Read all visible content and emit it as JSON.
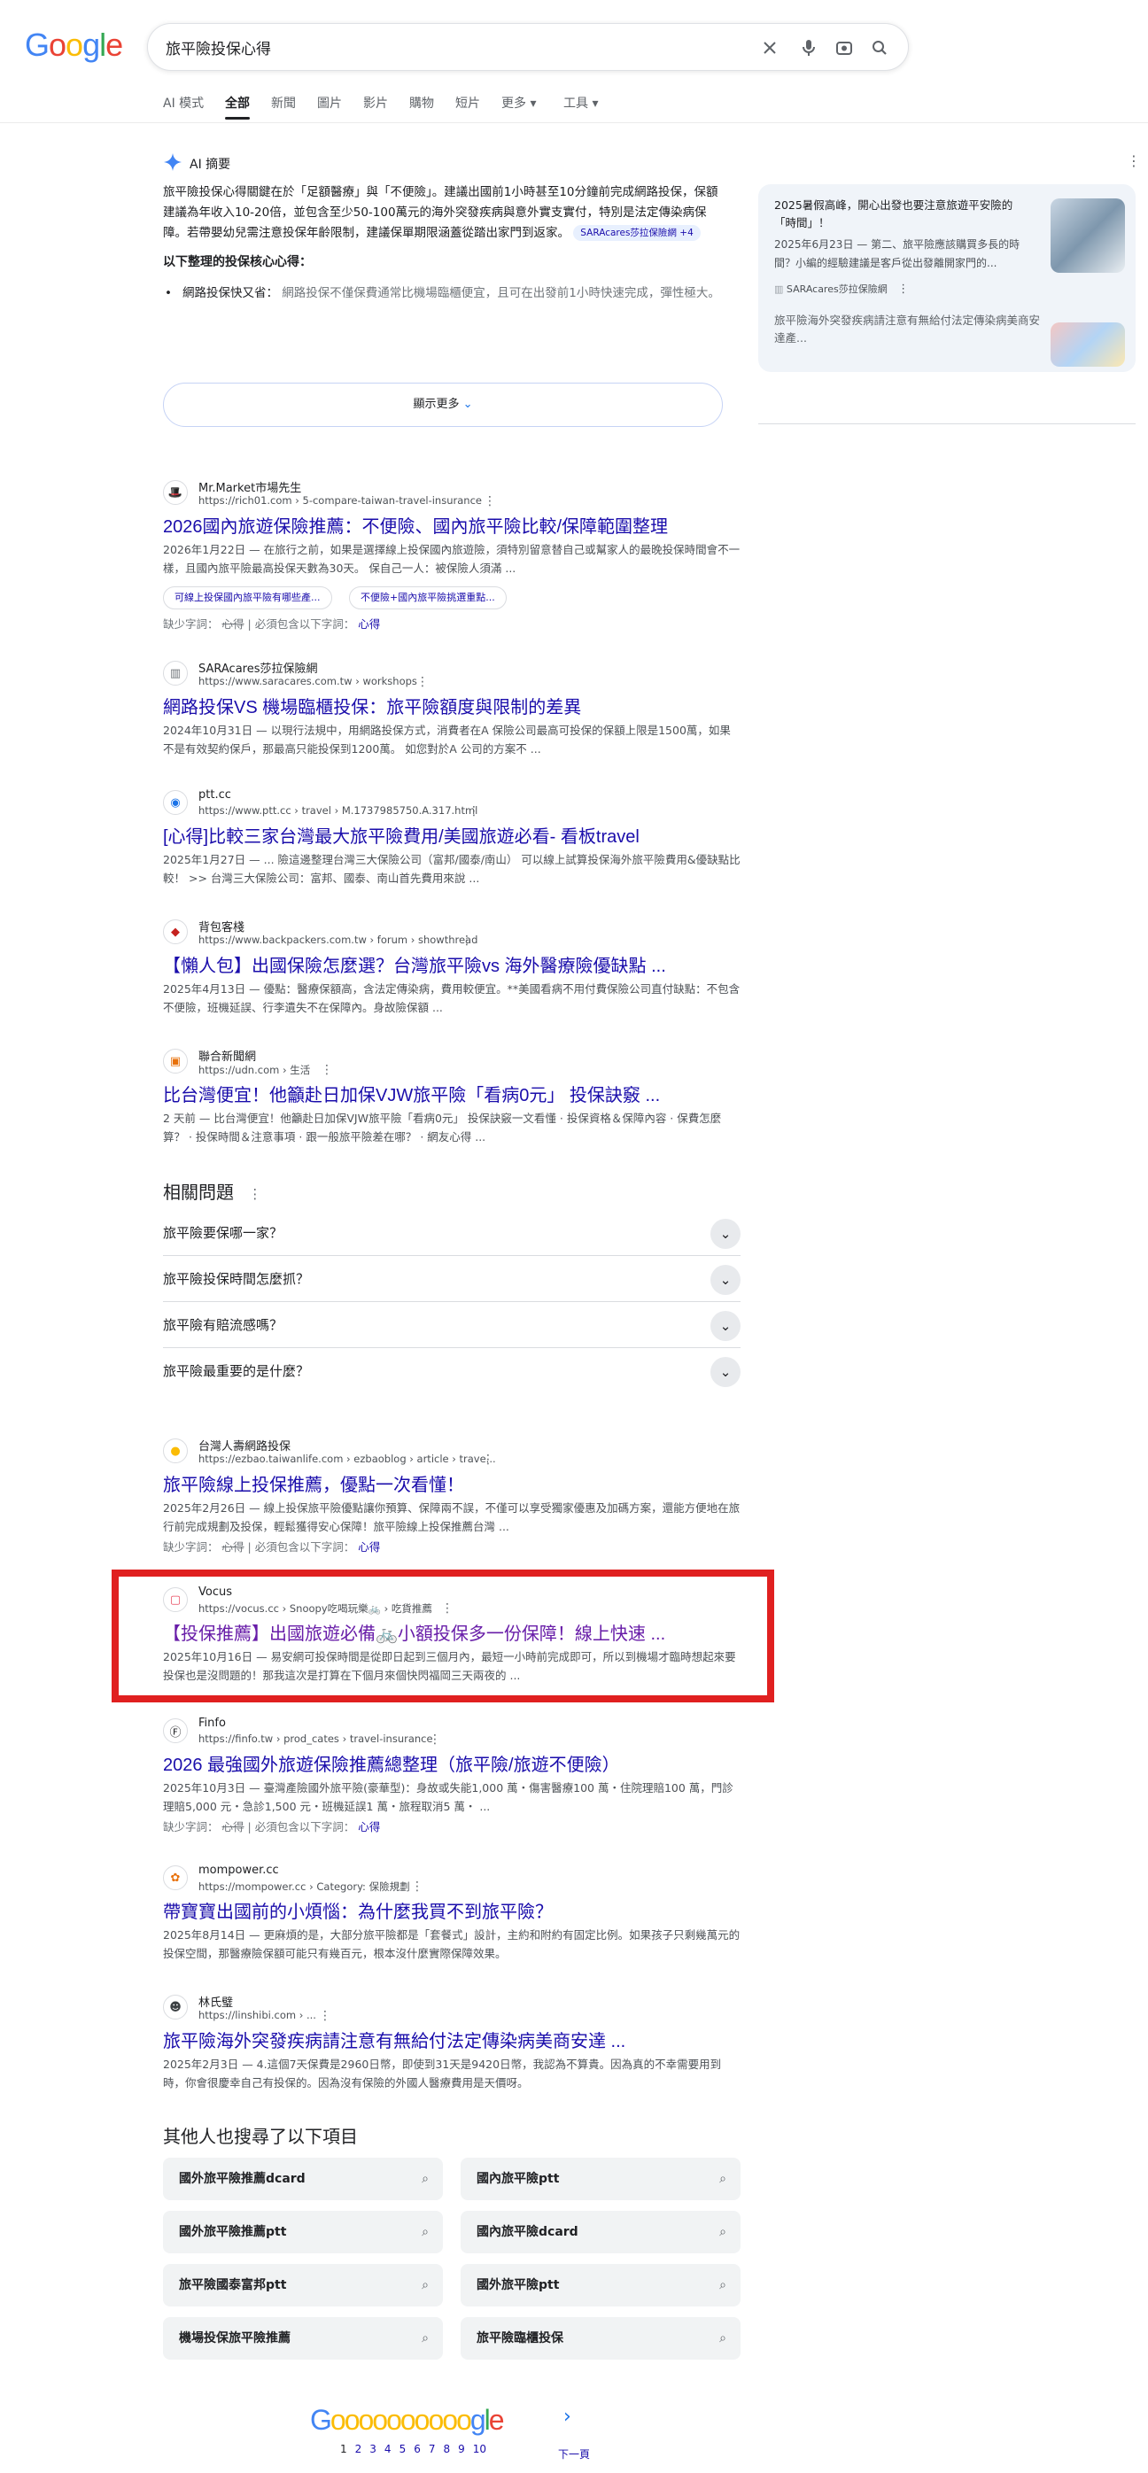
{
  "header": {
    "logo": "Google",
    "search_query": "旅平險投保心得",
    "tabs": [
      "AI 模式",
      "全部",
      "新聞",
      "圖片",
      "影片",
      "購物",
      "短片",
      "更多",
      "工具"
    ]
  },
  "ai_overview": {
    "label": "AI 摘要",
    "body": "旅平險投保心得關鍵在於「足額醫療」與「不便險」。建議出國前1小時甚至10分鐘前完成網路投保，保額建議為年收入10-20倍，並包含至少50-100萬元的海外突發疾病與意外實支實付，特別是法定傳染病保障。若帶嬰幼兒需注意投保年齡限制，建議保單期限涵蓋從踏出家門到返家。",
    "chip": "SARAcares莎拉保險網 +4",
    "subhead": "以下整理的投保核心心得：",
    "bullet_label": "網路投保快又省：",
    "bullet_text": "網路投保不僅保費通常比機場臨櫃便宜，且可在出發前1小時快速完成，彈性極大。",
    "show_more": "顯示更多",
    "side_cards": [
      {
        "title": "2025暑假高峰，開心出發也要注意旅遊平安險的「時間」！",
        "snippet": "2025年6月23日 — 第二、旅平險應該購買多長的時間？小編的經驗建議是客戶從出發離開家門的...",
        "source": "SARAcares莎拉保險網"
      },
      {
        "title": "旅平險海外突發疾病請注意有無給付法定傳染病美商安達產..."
      }
    ]
  },
  "results": [
    {
      "site": "Mr.Market市場先生",
      "url": "https://rich01.com › 5-compare-taiwan-travel-insurance",
      "title": "2026國內旅遊保險推薦：不便險、國內旅平險比較/保障範圍整理",
      "snippet": "2026年1月22日 — 在旅行之前，如果是選擇線上投保國內旅遊險，須特別留意替自己或幫家人的最晚投保時間會不一樣，且國內旅平險最高投保天數為30天。 保自己一人：被保險人須滿 ...",
      "pills": [
        "可線上投保國內旅平險有哪些產...",
        "不便險+國內旅平險挑選重點..."
      ],
      "missing_label": "缺少字詞：",
      "missing_word": "心得",
      "must_label": "必須包含以下字詞：",
      "must_word": "心得"
    },
    {
      "site": "SARAcares莎拉保險網",
      "url": "https://www.saracares.com.tw › workshops",
      "title": "網路投保VS 機場臨櫃投保：旅平險額度與限制的差異",
      "snippet": "2024年10月31日 — 以現行法規中，用網路投保方式，消費者在A 保險公司最高可投保的保額上限是1500萬，如果不是有效契約保戶，那最高只能投保到1200萬。 如您對於A 公司的方案不 ..."
    },
    {
      "site": "ptt.cc",
      "url": "https://www.ptt.cc › travel › M.1737985750.A.317.html",
      "title": "[心得]比較三家台灣最大旅平險費用/美國旅遊必看- 看板travel",
      "snippet": "2025年1月27日 — ... 險這邊整理台灣三大保險公司（富邦/國泰/南山） 可以線上試算投保海外旅平險費用&優缺點比較！ >> 台灣三大保險公司：富邦、國泰、南山首先費用來說 ..."
    },
    {
      "site": "背包客棧",
      "url": "https://www.backpackers.com.tw › forum › showthread",
      "title": "【懶人包】出國保險怎麼選？台灣旅平險vs 海外醫療險優缺點 ...",
      "snippet": "2025年4月13日 — 優點：醫療保額高，含法定傳染病，費用較便宜。**美國看病不用付費保險公司直付缺點：不包含不便險，班機延誤、行李遺失不在保障內。身故險保額 ..."
    },
    {
      "site": "聯合新聞網",
      "url": "https://udn.com › 生活",
      "title": "比台灣便宜！他籲赴日加保VJW旅平險「看病0元」 投保訣竅 ...",
      "snippet": "2 天前 — 比台灣便宜！他籲赴日加保VJW旅平險「看病0元」 投保訣竅一文看懂 · 投保資格＆保障內容 · 保費怎麼算？ · 投保時間＆注意事項 · 跟一般旅平險差在哪？ · 網友心得 ..."
    }
  ],
  "paa": {
    "title": "相關問題",
    "questions": [
      "旅平險要保哪一家？",
      "旅平險投保時間怎麼抓？",
      "旅平險有賠流感嗎？",
      "旅平險最重要的是什麼？"
    ]
  },
  "results2": [
    {
      "site": "台灣人壽網路投保",
      "url": "https://ezbao.taiwanlife.com › ezbaoblog › article › trave...",
      "title": "旅平險線上投保推薦，優點一次看懂！",
      "snippet": "2025年2月26日 — 線上投保旅平險優點讓你預算、保障兩不誤，不僅可以享受獨家優惠及加碼方案，還能方便地在旅行前完成規劃及投保，輕鬆獲得安心保障！旅平險線上投保推薦台灣 ...",
      "missing_label": "缺少字詞：",
      "missing_word": "心得",
      "must_label": "必須包含以下字詞：",
      "must_word": "心得"
    },
    {
      "site": "Vocus",
      "url": "https://vocus.cc › Snoopy吃喝玩樂🚲 › 吃貨推薦",
      "title": "【投保推薦】出國旅遊必備🚲小額投保多一份保障！線上快速 ...",
      "snippet": "2025年10月16日 — 易安網可投保時間是從即日起到三個月內，最短一小時前完成即可，所以到機場才臨時想起來要投保也是沒問題的！那我這次是打算在下個月來個快閃福岡三天兩夜的 ..."
    },
    {
      "site": "Finfo",
      "url": "https://finfo.tw › prod_cates › travel-insurance",
      "title": "2026 最強國外旅遊保險推薦總整理（旅平險/旅遊不便險）",
      "snippet": "2025年10月3日 — 臺灣產險國外旅平險(豪華型)：身故或失能1,000 萬・傷害醫療100 萬・住院理賠100 萬，門診理賠5,000 元・急診1,500 元・班機延誤1 萬・旅程取消5 萬・ ...",
      "missing_label": "缺少字詞：",
      "missing_word": "心得",
      "must_label": "必須包含以下字詞：",
      "must_word": "心得"
    },
    {
      "site": "mompower.cc",
      "url": "https://mompower.cc › Category: 保險規劃",
      "title": "帶寶寶出國前的小煩惱：為什麼我買不到旅平險？",
      "snippet": "2025年8月14日 — 更麻煩的是，大部分旅平險都是「套餐式」設計，主約和附約有固定比例。如果孩子只剩幾萬元的投保空間，那醫療險保額可能只有幾百元，根本沒什麼實際保障效果。"
    },
    {
      "site": "林氏璧",
      "url": "https://linshibi.com › ...",
      "title": "旅平險海外突發疾病請注意有無給付法定傳染病美商安達 ...",
      "snippet": "2025年2月3日 — 4.這個7天保費是2960日幣，即使到31天是9420日幣，我認為不算貴。因為真的不幸需要用到時，你會很慶幸自己有投保的。因為沒有保險的外國人醫療費用是天價呀。"
    }
  ],
  "others": {
    "title": "其他人也搜尋了以下項目",
    "items": [
      "國外旅平險推薦dcard",
      "國內旅平險ptt",
      "國外旅平險推薦ptt",
      "國內旅平險dcard",
      "旅平險國泰富邦ptt",
      "國外旅平險ptt",
      "機場投保旅平險推薦",
      "旅平險臨櫃投保"
    ]
  },
  "pager": {
    "pages": [
      "1",
      "2",
      "3",
      "4",
      "5",
      "6",
      "7",
      "8",
      "9",
      "10"
    ],
    "next": "下一頁"
  },
  "colors": {
    "link": "#1a0dab",
    "highlight_box": "#e02020",
    "emphasis": "#c5221f"
  }
}
